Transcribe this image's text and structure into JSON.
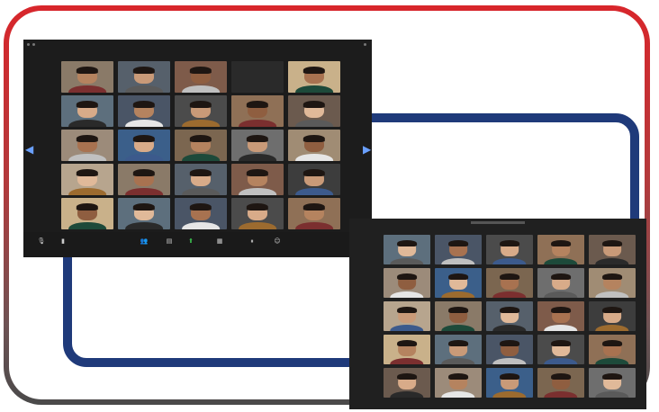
{
  "screens": {
    "left": {
      "toolbar": [
        {
          "icon": "mic-icon",
          "glyph": "🎙"
        },
        {
          "icon": "video-icon",
          "glyph": "▮"
        },
        {
          "icon": "participants-icon",
          "glyph": "👥"
        },
        {
          "icon": "chat-icon",
          "glyph": "▤"
        },
        {
          "icon": "share-screen-icon",
          "glyph": "⬆"
        },
        {
          "icon": "breakout-rooms-icon",
          "glyph": "▦"
        },
        {
          "icon": "record-icon",
          "glyph": "⏸"
        },
        {
          "icon": "reactions-icon",
          "glyph": "☺"
        }
      ]
    }
  },
  "colors": {
    "frame_top": "#d8262b",
    "frame_bottom": "#4a4a4a",
    "blue_frame": "#1f3a7a",
    "window_bg": "#1c1c1c",
    "share_green": "#3bbf4e"
  }
}
